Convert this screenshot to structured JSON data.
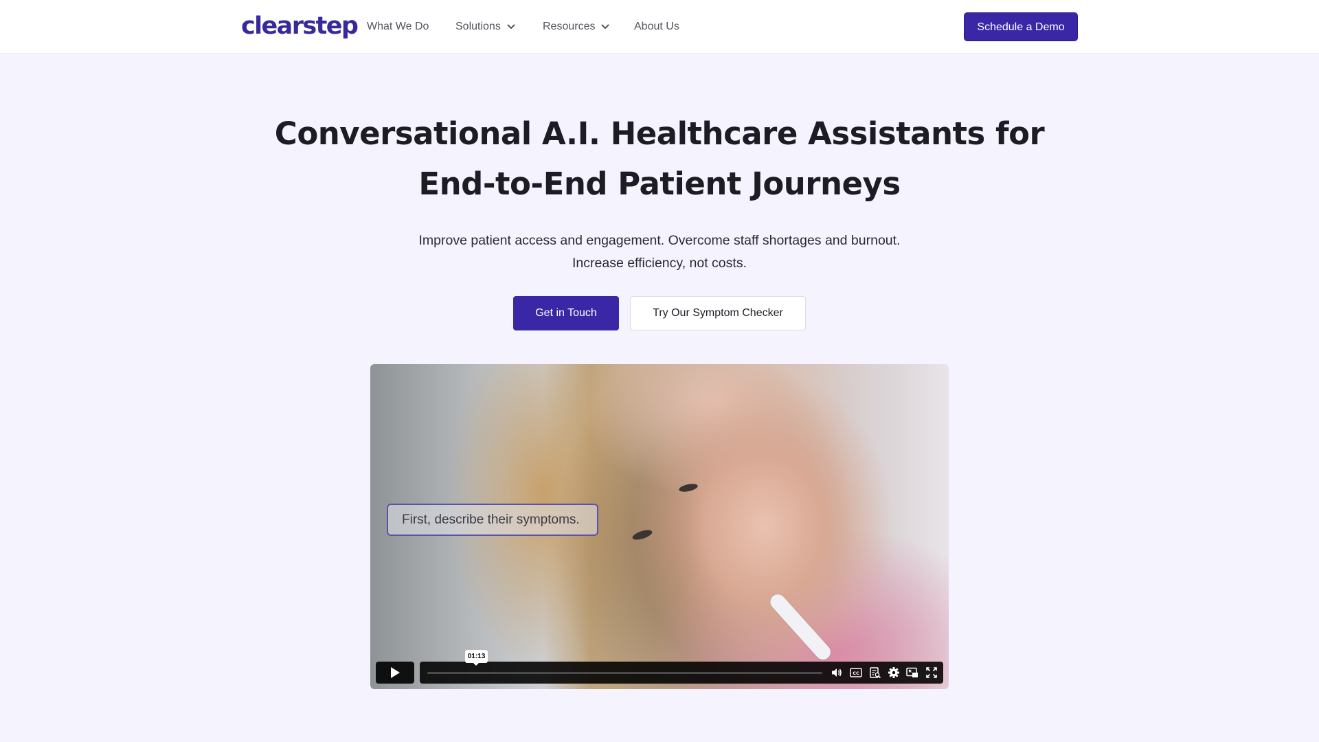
{
  "header": {
    "logo": "clearstep",
    "nav": [
      {
        "label": "What We Do",
        "has_dropdown": false
      },
      {
        "label": "Solutions",
        "has_dropdown": true
      },
      {
        "label": "Resources",
        "has_dropdown": true
      },
      {
        "label": "About Us",
        "has_dropdown": false
      }
    ],
    "cta_label": "Schedule a Demo"
  },
  "hero": {
    "title_line1": "Conversational A.I. Healthcare Assistants for",
    "title_line2": "End-to-End Patient Journeys",
    "subtitle_line1": "Improve patient access and engagement. Overcome staff shortages and burnout.",
    "subtitle_line2": "Increase efficiency, not costs.",
    "primary_button": "Get in Touch",
    "secondary_button": "Try Our Symptom Checker"
  },
  "video": {
    "caption": "First, describe their symptoms.",
    "hover_time": "01:13",
    "progress_fraction": 0.0,
    "controls": [
      "play-icon",
      "volume-icon",
      "closed-captions-icon",
      "transcript-icon",
      "settings-icon",
      "picture-in-picture-icon",
      "fullscreen-icon"
    ]
  },
  "colors": {
    "brand": "#37289b",
    "button_primary": "#3a27a6",
    "page_background": "#f5f4fe",
    "header_background": "#ffffff",
    "text_primary": "#1d1c24",
    "nav_text": "#55545f"
  }
}
